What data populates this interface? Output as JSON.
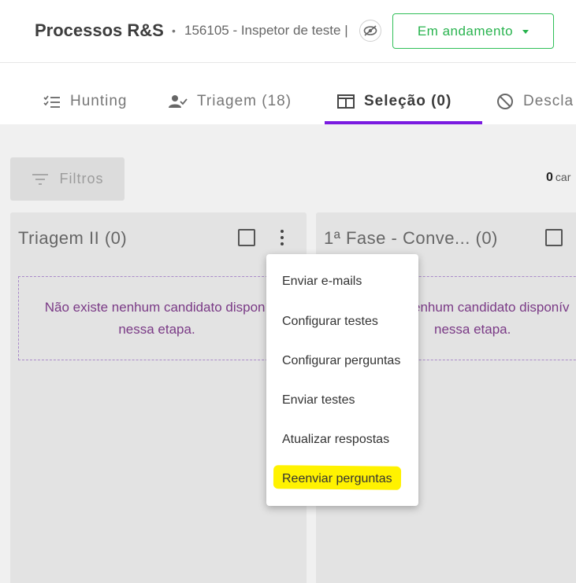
{
  "header": {
    "title": "Processos R&S",
    "separator": "•",
    "subtitle": "156105 - Inspetor de teste |",
    "status": {
      "label": "Em andamento"
    }
  },
  "tabs": [
    {
      "label": "Hunting",
      "icon": "checklist-icon"
    },
    {
      "label": "Triagem (18)",
      "icon": "person-check-icon"
    },
    {
      "label": "Seleção (0)",
      "icon": "columns-icon",
      "active": true
    },
    {
      "label": "Descla",
      "icon": "block-icon"
    }
  ],
  "filters": {
    "label": "Filtros"
  },
  "count": {
    "value": "0",
    "rest": "car"
  },
  "columns": [
    {
      "title": "Triagem II (0)",
      "empty_line1": "Não existe nenhum candidato disponí",
      "empty_line2": "nessa etapa."
    },
    {
      "title": "1ª Fase - Conve... (0)",
      "empty_line1": "enhum candidato disponív",
      "empty_line2": "nessa etapa."
    }
  ],
  "menu": {
    "items": [
      "Enviar e-mails",
      "Configurar testes",
      "Configurar perguntas",
      "Enviar testes",
      "Atualizar respostas",
      "Reenviar perguntas"
    ],
    "highlighted_index": 5,
    "highlight_color": "#fff200"
  },
  "colors": {
    "accent": "#7a1be0",
    "status": "#28b34e",
    "empty_text": "#7a3a86"
  }
}
